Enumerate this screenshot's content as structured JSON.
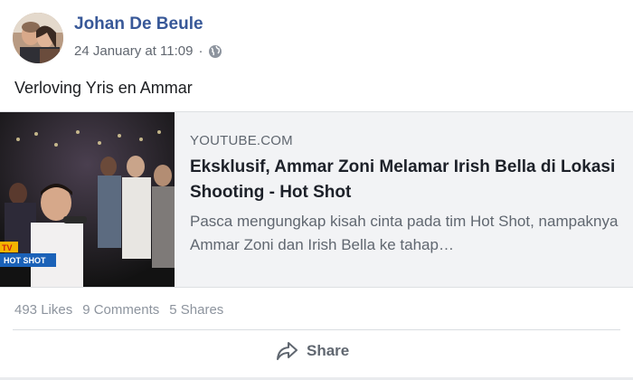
{
  "post": {
    "author": "Johan De Beule",
    "timestamp": "24 January at 11:09",
    "separator": "·",
    "privacy_icon": "globe-icon",
    "text": "Verloving Yris en Ammar"
  },
  "link_preview": {
    "domain": "YOUTUBE.COM",
    "title": "Eksklusif, Ammar Zoni Melamar Irish Bella di Lokasi Shooting - Hot Shot",
    "description": "Pasca mengungkap kisah cinta pada tim Hot Shot, nampaknya Ammar Zoni dan Irish Bella ke tahap…",
    "thumbnail_badge": "HOT SHOT",
    "thumbnail_channel": "TV"
  },
  "stats": {
    "likes": "493 Likes",
    "comments": "9 Comments",
    "shares": "5 Shares"
  },
  "actions": {
    "share_label": "Share",
    "share_icon": "share-arrow-icon"
  },
  "colors": {
    "author_link": "#385898",
    "card_bg": "#f2f3f5",
    "muted_text": "#606770"
  }
}
